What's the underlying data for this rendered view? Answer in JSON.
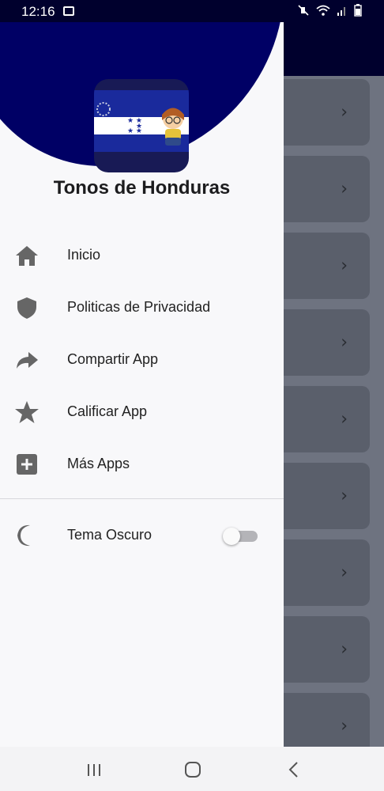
{
  "status_bar": {
    "time": "12:16",
    "icons": [
      "image-icon",
      "mute-icon",
      "wifi-icon",
      "signal-icon",
      "battery-icon"
    ]
  },
  "drawer": {
    "app_title": "Tonos de Honduras",
    "menu": [
      {
        "label": "Inicio",
        "icon": "home-icon"
      },
      {
        "label": "Politicas de Privacidad",
        "icon": "shield-icon"
      },
      {
        "label": "Compartir App",
        "icon": "share-icon"
      },
      {
        "label": "Calificar App",
        "icon": "star-icon"
      },
      {
        "label": "Más Apps",
        "icon": "plus-box-icon"
      }
    ],
    "theme_toggle": {
      "label": "Tema Oscuro",
      "icon": "moon-icon",
      "enabled": false
    }
  },
  "colors": {
    "header": "#000065",
    "drawer_bg": "#f8f8fa",
    "icon_gray": "#666666"
  },
  "nav_bar": {
    "buttons": [
      "recent-apps-icon",
      "home-button-icon",
      "back-icon"
    ]
  }
}
